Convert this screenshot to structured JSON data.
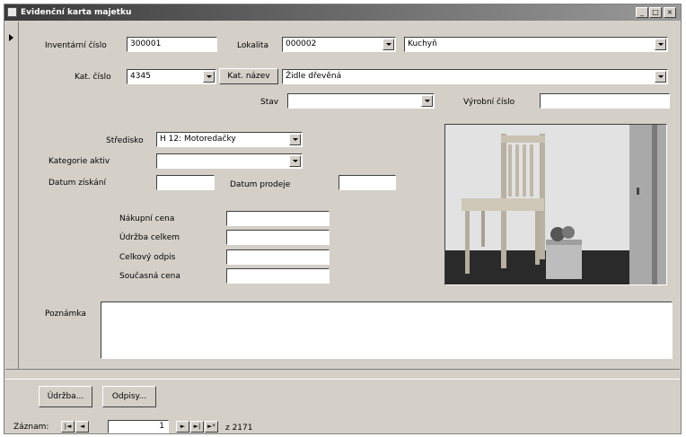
{
  "window": {
    "title": "Evidenční karta majetku",
    "controls": {
      "minimize": "_",
      "maximize": "□",
      "close": "×"
    }
  },
  "form": {
    "inventarni_cislo": {
      "label": "Inventární číslo",
      "value": "300001"
    },
    "lokalita": {
      "label": "Lokalita",
      "code": "000002",
      "name": "Kuchyň"
    },
    "kat_cislo": {
      "label": "Kat. číslo",
      "value": "4345",
      "button": "Kat. název",
      "name": "Židle dřevěná"
    },
    "stav": {
      "label": "Stav",
      "value": ""
    },
    "vyrobni_cislo": {
      "label": "Výrobní číslo",
      "value": ""
    },
    "stredisko": {
      "label": "Středisko",
      "value": "H 12: Motoredačky"
    },
    "kategorie_aktiv": {
      "label": "Kategorie aktiv",
      "value": ""
    },
    "datum_ziskani": {
      "label": "Datum získání",
      "value": ""
    },
    "datum_prodeje": {
      "label": "Datum prodeje",
      "value": ""
    },
    "nakupni_cena": {
      "label": "Nákupní cena",
      "value": ""
    },
    "udrzba_celkem": {
      "label": "Údržba celkem",
      "value": ""
    },
    "celkovy_odpis": {
      "label": "Celkový odpis",
      "value": ""
    },
    "soucasna_cena": {
      "label": "Současná cena",
      "value": ""
    },
    "poznamka": {
      "label": "Poznámka",
      "value": ""
    }
  },
  "buttons": {
    "udrzba": "Údržba...",
    "odpisy": "Odpisy..."
  },
  "navigation": {
    "label": "Záznam:",
    "current": "1",
    "total": "z 2171",
    "first_icon": "first-record-icon",
    "prev_icon": "prev-record-icon",
    "next_icon": "next-record-icon",
    "last_icon": "last-record-icon",
    "new_icon": "new-record-icon"
  }
}
